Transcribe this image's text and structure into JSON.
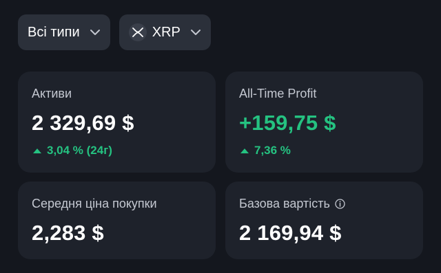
{
  "filters": {
    "type_filter": "Всі типи",
    "asset_filter": "XRP",
    "asset_icon": "xrp-icon"
  },
  "cards": {
    "assets": {
      "label": "Активи",
      "value": "2 329,69 $",
      "change": "3,04 % (24г)",
      "trend": "up"
    },
    "profit": {
      "label": "All-Time Profit",
      "value": "+159,75 $",
      "change": "7,36 %",
      "trend": "up"
    },
    "avg_price": {
      "label": "Середня ціна покупки",
      "value": "2,283 $"
    },
    "cost_basis": {
      "label": "Базова вартість",
      "value": "2 169,94 $",
      "info_icon": "info-icon"
    }
  },
  "colors": {
    "background": "#14171e",
    "card": "#1e222b",
    "pill": "#2b303a",
    "positive": "#25c281",
    "muted_text": "#c4c8d1"
  }
}
